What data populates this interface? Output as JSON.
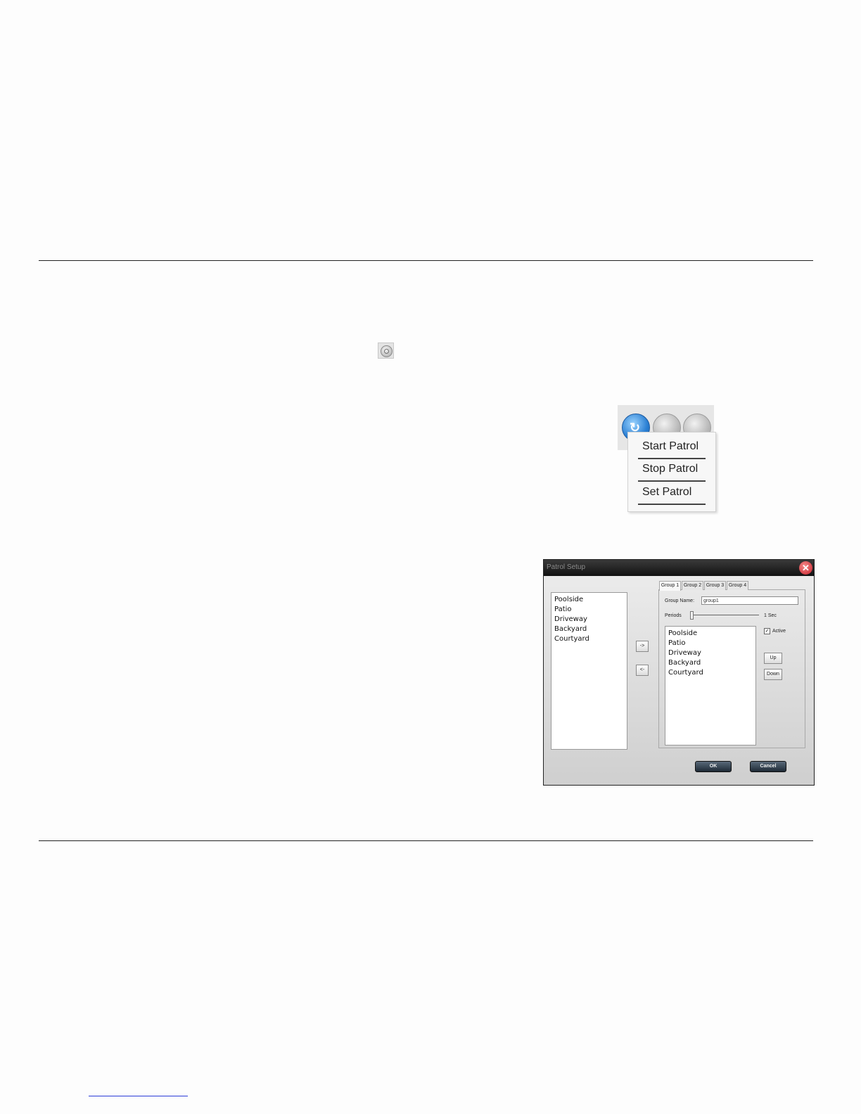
{
  "patrol_menu": {
    "items": [
      "Start Patrol",
      "Stop Patrol",
      "Set Patrol"
    ]
  },
  "dialog": {
    "title": "Patrol Setup",
    "available_cameras": [
      "Poolside",
      "Patio",
      "Driveway",
      "Backyard",
      "Courtyard"
    ],
    "move_right_label": "->",
    "move_left_label": "<-",
    "tabs": [
      "Group 1",
      "Group 2",
      "Group 3",
      "Group 4"
    ],
    "group_name_label": "Group Name:",
    "group_name_value": "group1",
    "periods_label": "Periods",
    "periods_value": "1 Sec",
    "group_cameras": [
      "Poolside",
      "Patio",
      "Driveway",
      "Backyard",
      "Courtyard"
    ],
    "active_label": "Active",
    "active_checked": true,
    "up_label": "Up",
    "down_label": "Down",
    "ok_label": "OK",
    "cancel_label": "Cancel"
  },
  "icons": {
    "close": "close-icon",
    "patrol": "patrol-icon"
  }
}
